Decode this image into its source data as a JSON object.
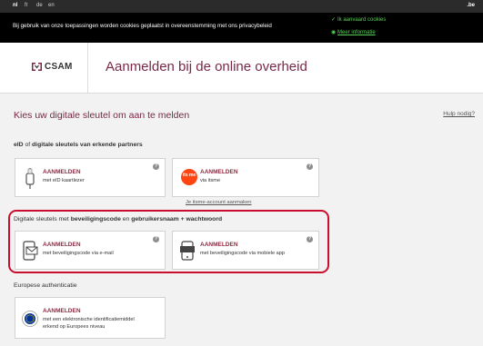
{
  "topbar": {
    "languages": [
      {
        "code": "nl",
        "active": true
      },
      {
        "code": "fr",
        "active": false
      },
      {
        "code": "de",
        "active": false
      },
      {
        "code": "en",
        "active": false
      }
    ],
    "domain": ".be"
  },
  "cookie": {
    "text": "Bij gebruik van onze toepassingen worden cookies geplaatst in overeenstemming met ons privacybeleid",
    "accept": "Ik aanvaard cookies",
    "more": "Meer informatie",
    "accent": "#53d353"
  },
  "header": {
    "logo": "CSAM",
    "title": "Aanmelden bij de online overheid"
  },
  "main": {
    "heading": "Kies uw digitale sleutel om aan te melden",
    "help": "Hulp nodig?",
    "section1": {
      "pre": "eID",
      "mid": " of ",
      "post": "digitale sleutels van erkende partners"
    },
    "section2": {
      "a": "Digitale sleutels met ",
      "b": "beveiligingscode",
      "c": " en ",
      "d": "gebruikersnaam + wachtwoord"
    },
    "section3": "Europese authenticatie",
    "itsme_link": "Je itsme-account aanmaken",
    "cards": [
      {
        "icon": "card-reader-icon",
        "title": "AANMELDEN",
        "sub": "met eID kaartlezer"
      },
      {
        "icon": "itsme-icon",
        "title": "AANMELDEN",
        "sub": "via itsme"
      },
      {
        "icon": "email-code-icon",
        "title": "AANMELDEN",
        "sub": "met beveiligingscode via e-mail"
      },
      {
        "icon": "mobile-app-icon",
        "title": "AANMELDEN",
        "sub": "met beveiligingscode via mobiele app"
      },
      {
        "icon": "eu-stars-icon",
        "title": "AANMELDEN",
        "sub1": "met een elektronische identificatiemiddel",
        "sub2": "erkend op Europees niveau"
      }
    ],
    "itsme_logo_text": "its me",
    "help_glyph": "?"
  },
  "colors": {
    "brand": "#7a2848",
    "highlight": "#c8102e",
    "itsme": "#ff4612"
  }
}
